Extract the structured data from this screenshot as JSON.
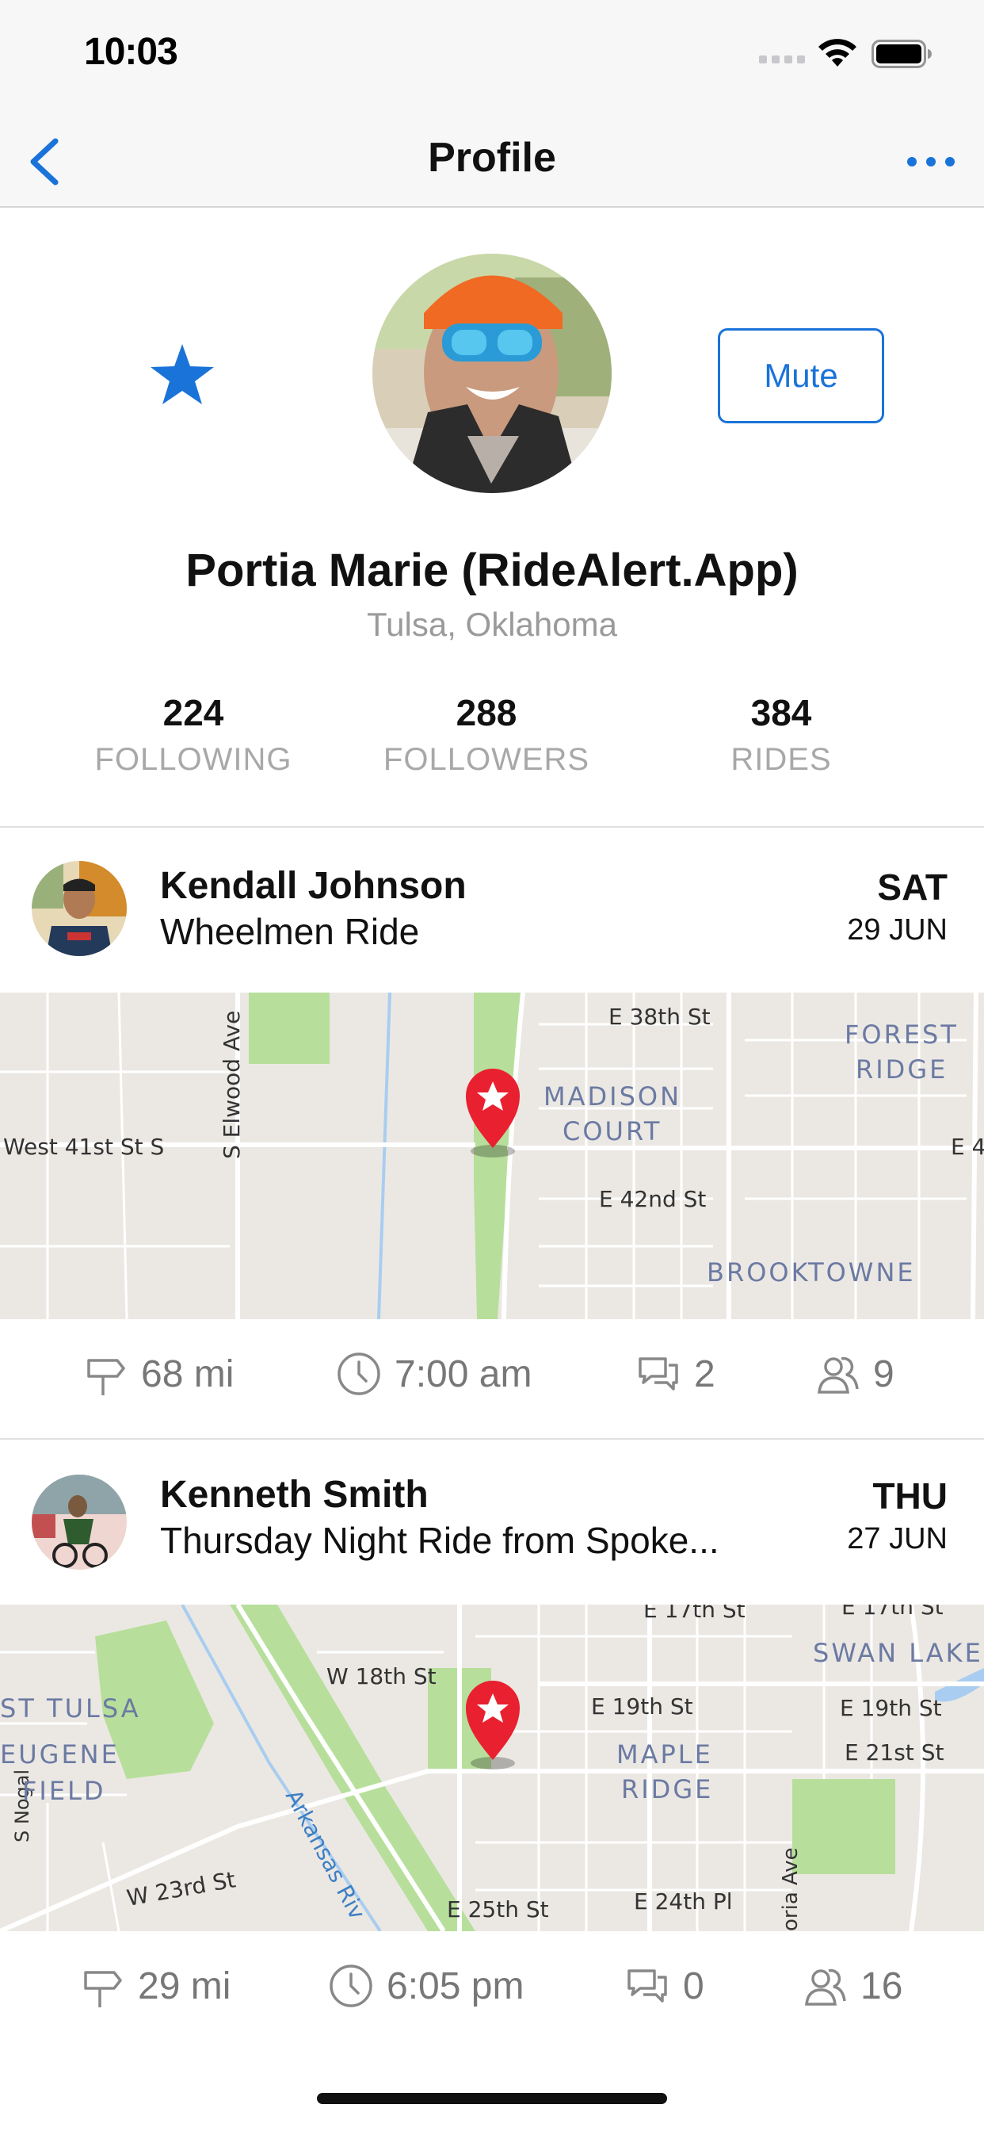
{
  "status_bar": {
    "time": "10:03"
  },
  "nav": {
    "title": "Profile"
  },
  "profile": {
    "name": "Portia Marie (RideAlert.App)",
    "location": "Tulsa, Oklahoma",
    "mute_label": "Mute",
    "stats": [
      {
        "value": "224",
        "label": "FOLLOWING"
      },
      {
        "value": "288",
        "label": "FOLLOWERS"
      },
      {
        "value": "384",
        "label": "RIDES"
      }
    ]
  },
  "rides": [
    {
      "rider": "Kendall Johnson",
      "title": "Wheelmen Ride",
      "day": "SAT",
      "date": "29 JUN",
      "distance": "68 mi",
      "time": "7:00 am",
      "comments": "2",
      "riders": "9",
      "map_labels": [
        "E 38th St",
        "FOREST",
        "RIDGE",
        "MADISON",
        "COURT",
        "West 41st St S",
        "S Elwood Ave",
        "E 4",
        "E 42nd St",
        "BROOKTOWNE"
      ]
    },
    {
      "rider": "Kenneth Smith",
      "title": "Thursday Night Ride from Spoke...",
      "day": "THU",
      "date": "27 JUN",
      "distance": "29 mi",
      "time": "6:05 pm",
      "comments": "0",
      "riders": "16",
      "map_labels": [
        "E 17th St",
        "E 17th St",
        "SWAN LAKE",
        "W 18th St",
        "ST TULSA",
        "E 19th St",
        "E 19th St",
        "EUGENE",
        "FIELD",
        "MAPLE",
        "RIDGE",
        "E 21st St",
        "Arkansas Riv",
        "W 23rd St",
        "S Nogal",
        "E 25th St",
        "E 24th Pl",
        "oria Ave"
      ]
    }
  ],
  "colors": {
    "accent": "#1a73d9",
    "pin": "#e8202f",
    "park": "#b7df9b",
    "road": "#ffffff",
    "map_bg": "#ebe8e3",
    "river": "#a9cdf0"
  }
}
